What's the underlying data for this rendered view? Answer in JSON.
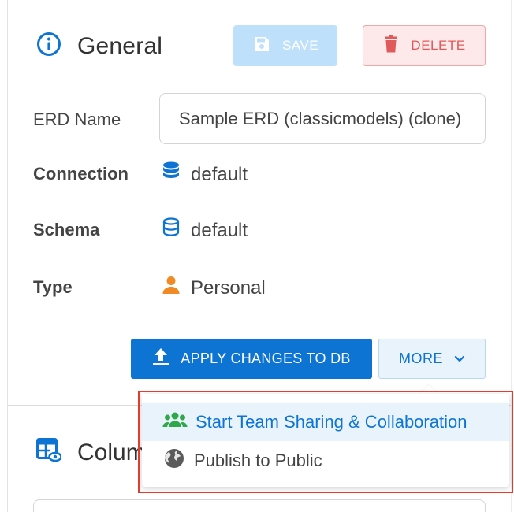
{
  "general": {
    "title": "General",
    "save_label": "SAVE",
    "delete_label": "DELETE"
  },
  "fields": {
    "erd_name": {
      "label": "ERD Name",
      "value": "Sample ERD (classicmodels) (clone)"
    },
    "connection": {
      "label": "Connection",
      "value": "default"
    },
    "schema": {
      "label": "Schema",
      "value": "default"
    },
    "type": {
      "label": "Type",
      "value": "Personal"
    }
  },
  "actions": {
    "apply_label": "APPLY CHANGES TO DB",
    "more_label": "MORE"
  },
  "menu": {
    "items": [
      {
        "label": "Start Team Sharing & Collaboration",
        "icon": "group-icon"
      },
      {
        "label": "Publish to Public",
        "icon": "globe-icon"
      }
    ]
  },
  "columns": {
    "title": "Columns"
  },
  "colors": {
    "primary": "#0d74d4",
    "save_disabled": "#bfe0fb",
    "delete": "#e05a5a",
    "share_icon": "#2ea84a",
    "type_icon": "#f08a24",
    "highlight": "#e53a2e"
  }
}
